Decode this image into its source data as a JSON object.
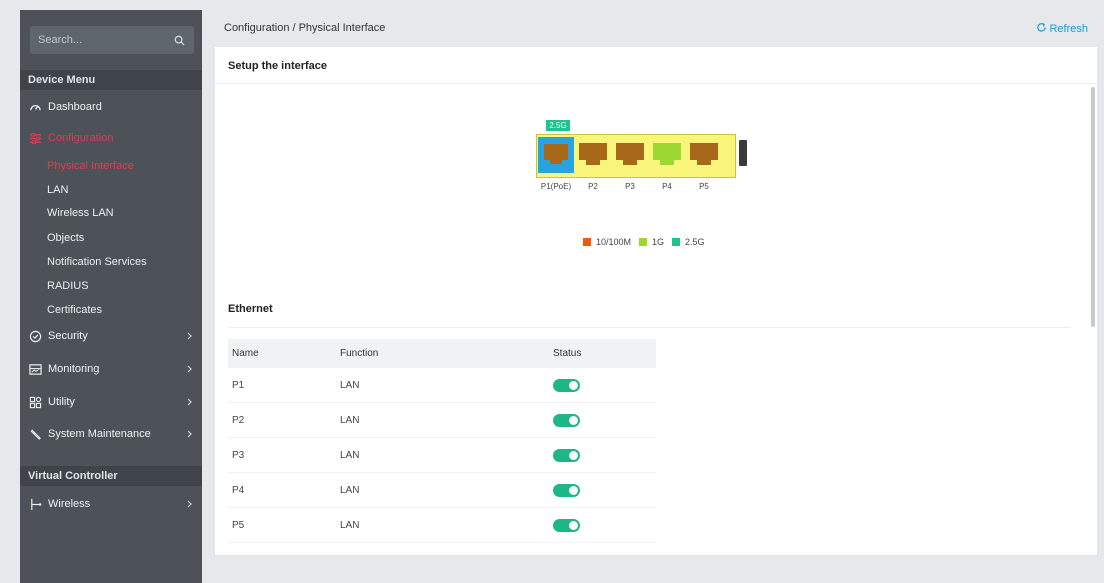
{
  "sidebar": {
    "search_placeholder": "Search...",
    "device_menu_label": "Device Menu",
    "items": [
      {
        "label": "Dashboard",
        "icon": "dashboard-icon"
      },
      {
        "label": "Configuration",
        "icon": "configuration-icon",
        "active": true
      },
      {
        "label": "Security",
        "icon": "shield-check-icon"
      },
      {
        "label": "Monitoring",
        "icon": "monitor-icon"
      },
      {
        "label": "Utility",
        "icon": "utility-grid-icon"
      },
      {
        "label": "System Maintenance",
        "icon": "wrench-icon"
      }
    ],
    "config_subitems": [
      "Physical Interface",
      "LAN",
      "Wireless LAN",
      "Objects",
      "Notification Services",
      "RADIUS",
      "Certificates"
    ],
    "virtual_controller_label": "Virtual Controller",
    "vc_items": [
      {
        "label": "Wireless",
        "icon": "wireless-branch-icon"
      }
    ]
  },
  "topbar": {
    "breadcrumb": "Configuration / Physical Interface",
    "refresh_label": "Refresh"
  },
  "setup": {
    "title": "Setup the interface",
    "speed_badge": "2.5G",
    "ports": [
      "P1(PoE)",
      "P2",
      "P3",
      "P4",
      "P5"
    ],
    "legend": [
      {
        "label": "10/100M",
        "color": "#f05a0c"
      },
      {
        "label": "1G",
        "color": "#9dd733"
      },
      {
        "label": "2.5G",
        "color": "#1fc48d"
      }
    ]
  },
  "ethernet": {
    "title": "Ethernet",
    "columns": [
      "Name",
      "Function",
      "Status"
    ],
    "rows": [
      {
        "name": "P1",
        "function": "LAN",
        "status": true
      },
      {
        "name": "P2",
        "function": "LAN",
        "status": true
      },
      {
        "name": "P3",
        "function": "LAN",
        "status": true
      },
      {
        "name": "P4",
        "function": "LAN",
        "status": true
      },
      {
        "name": "P5",
        "function": "LAN",
        "status": true
      }
    ]
  },
  "colors": {
    "active_nav": "#e8384f",
    "toggle_on": "#1fb685",
    "link": "#1a9bd7",
    "port_brown": "#a8681a",
    "port_green": "#9dd733",
    "port_selected_bg": "#27a4de"
  }
}
